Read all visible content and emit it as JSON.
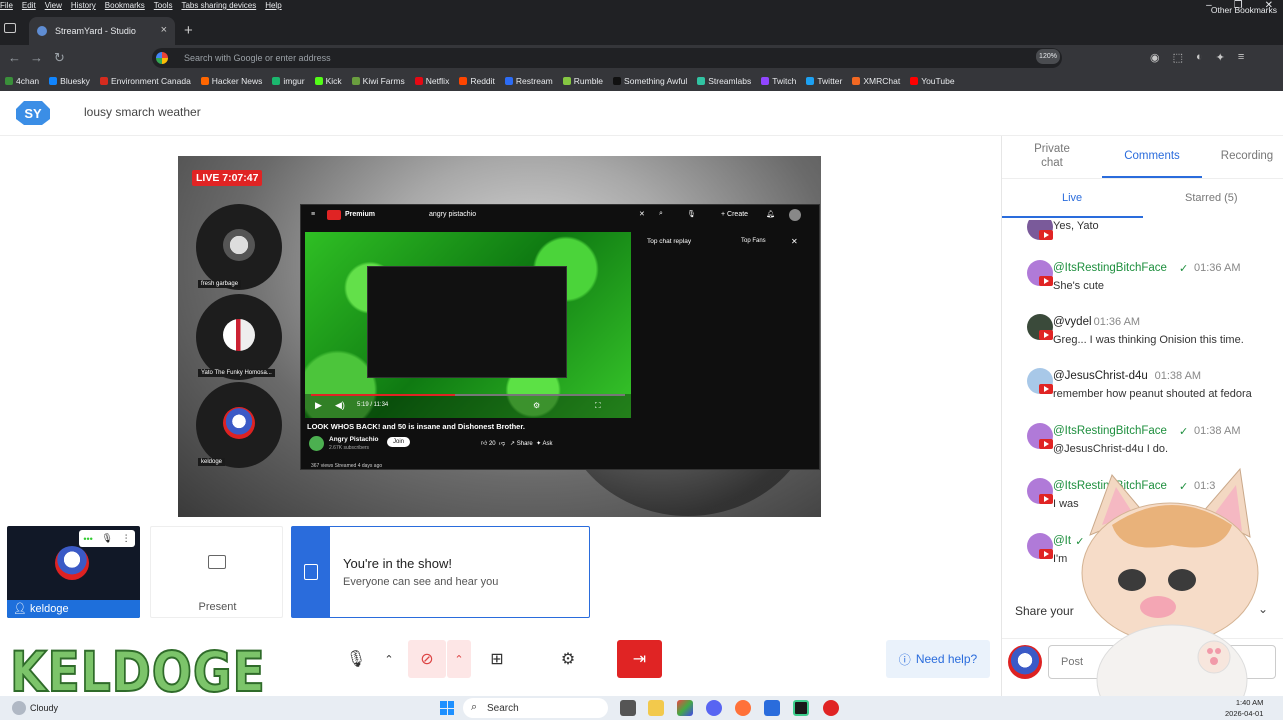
{
  "browser": {
    "menu": [
      "File",
      "Edit",
      "View",
      "History",
      "Bookmarks",
      "Tools",
      "Tabs sharing devices",
      "Help"
    ],
    "tab_title": "StreamYard - Studio",
    "address_placeholder": "Search with Google or enter address",
    "zoom": "120%",
    "bookmarks": [
      {
        "label": "4chan",
        "color": "#3a8f3a"
      },
      {
        "label": "Bluesky",
        "color": "#1185fe"
      },
      {
        "label": "Environment Canada",
        "color": "#d52b1e"
      },
      {
        "label": "Hacker News",
        "color": "#ff6600"
      },
      {
        "label": "imgur",
        "color": "#1bb76e"
      },
      {
        "label": "Kick",
        "color": "#53fc18"
      },
      {
        "label": "Kiwi Farms",
        "color": "#6a9e3f"
      },
      {
        "label": "Netflix",
        "color": "#e50914"
      },
      {
        "label": "Reddit",
        "color": "#ff4500"
      },
      {
        "label": "Restream",
        "color": "#2c6cf6"
      },
      {
        "label": "Rumble",
        "color": "#85c742"
      },
      {
        "label": "Something Awful",
        "color": "#111111"
      },
      {
        "label": "Streamlabs",
        "color": "#31c3a2"
      },
      {
        "label": "Twitch",
        "color": "#9146ff"
      },
      {
        "label": "Twitter",
        "color": "#1da1f2"
      },
      {
        "label": "XMRChat",
        "color": "#f26822"
      },
      {
        "label": "YouTube",
        "color": "#ff0000"
      }
    ],
    "other_bookmarks": "Other Bookmarks"
  },
  "app": {
    "stream_title": "lousy smarch weather",
    "live_timer": "LIVE 7:07:47",
    "guests": [
      {
        "label": "fresh garbage"
      },
      {
        "label": "Yato The Funky Homosa..."
      },
      {
        "label": "keldoge"
      }
    ],
    "shared_screen": {
      "search": "angry pistachio",
      "brand": "Premium",
      "create": "Create",
      "time": "5:19 / 11:34",
      "progress": 0.46,
      "video_title": "LOOK WHOS BACK! and 50 is insane and Dishonest Brother.",
      "channel": "Angry Pistachio",
      "subs": "2.67K subscribers",
      "join": "Join",
      "likes": "20",
      "share": "Share",
      "ask": "Ask",
      "stats": "367 views  Streamed 4 days ago",
      "chat_header": "Top chat replay",
      "top_fans": "Top Fans"
    },
    "my_tile_name": "keldoge",
    "present_label": "Present",
    "in_show_title": "You're in the show!",
    "in_show_sub": "Everyone can see and hear you",
    "need_help": "Need help?",
    "overlay_logo": "KELDOGE"
  },
  "panel": {
    "tabs": [
      "Private chat",
      "Comments",
      "Recording"
    ],
    "subtabs": [
      "Live",
      "Starred (5)"
    ],
    "comments": [
      {
        "author": "",
        "time": "",
        "msg": "Yes, Yato",
        "verified": false,
        "avatar": "#7a5a9a"
      },
      {
        "author": "@ItsRestingBitchFace",
        "time": "01:36 AM",
        "msg": "She's cute",
        "verified": true,
        "avatar": "#b07ad8"
      },
      {
        "author": "@vydel",
        "time": "01:36 AM",
        "msg": "Greg... I was thinking Onision this time.",
        "verified": false,
        "avatar": "#3a4a3a"
      },
      {
        "author": "@JesusChrist-d4u",
        "time": "01:38 AM",
        "msg": "remember how peanut shouted at fedora",
        "verified": false,
        "avatar": "#a8c8e8"
      },
      {
        "author": "@ItsRestingBitchFace",
        "time": "01:38 AM",
        "msg": "@JesusChrist-d4u I do.",
        "verified": true,
        "avatar": "#b07ad8"
      },
      {
        "author": "@ItsRestingBitchFace",
        "time": "01:3",
        "msg": "I was",
        "verified": true,
        "avatar": "#b07ad8"
      },
      {
        "author": "@It",
        "time": "",
        "msg": "I'm",
        "verified": true,
        "avatar": "#b07ad8"
      }
    ],
    "share_label": "Share your",
    "post_placeholder": "Post"
  },
  "taskbar": {
    "weather": "Cloudy",
    "search": "Search",
    "time": "1:40 AM",
    "date": "2026-04-01"
  }
}
